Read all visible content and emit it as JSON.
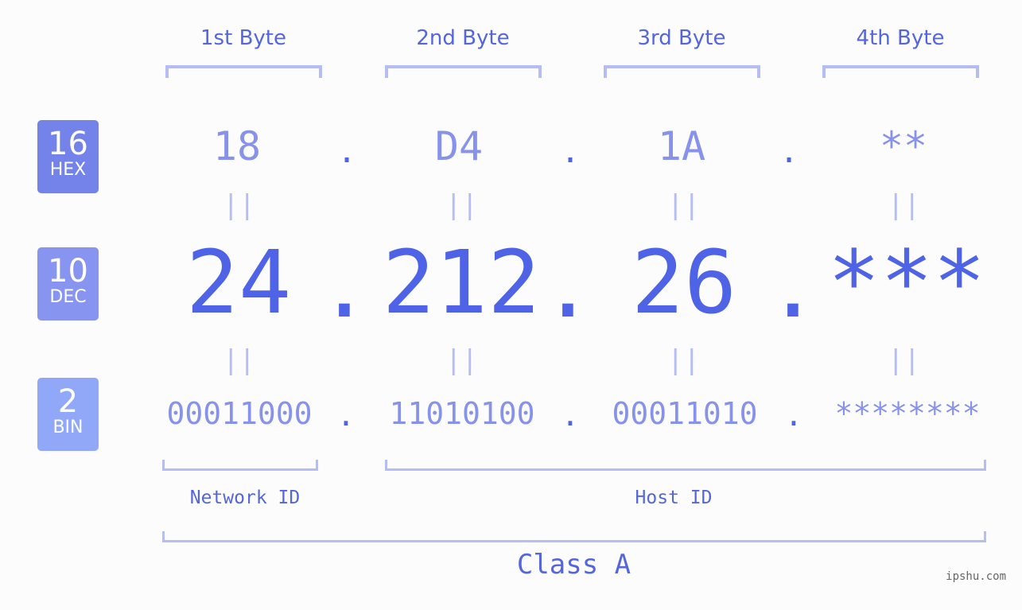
{
  "badges": [
    {
      "num": "16",
      "label": "HEX",
      "color": "#7383ea"
    },
    {
      "num": "10",
      "label": "DEC",
      "color": "#8794f0"
    },
    {
      "num": "2",
      "label": "BIN",
      "color": "#91a8f8"
    }
  ],
  "byte_headers": [
    "1st Byte",
    "2nd Byte",
    "3rd Byte",
    "4th Byte"
  ],
  "separator": ".",
  "equals": "||",
  "hex": [
    "18",
    "D4",
    "1A",
    "**"
  ],
  "dec": [
    "24",
    "212",
    "26",
    "***"
  ],
  "bin": [
    "00011000",
    "11010100",
    "00011010",
    "********"
  ],
  "network_id_label": "Network ID",
  "host_id_label": "Host ID",
  "class_label": "Class A",
  "watermark": "ipshu.com",
  "colors": {
    "accent": "#4e63e6",
    "light": "#8792ea",
    "bracket": "#b4bef5"
  }
}
